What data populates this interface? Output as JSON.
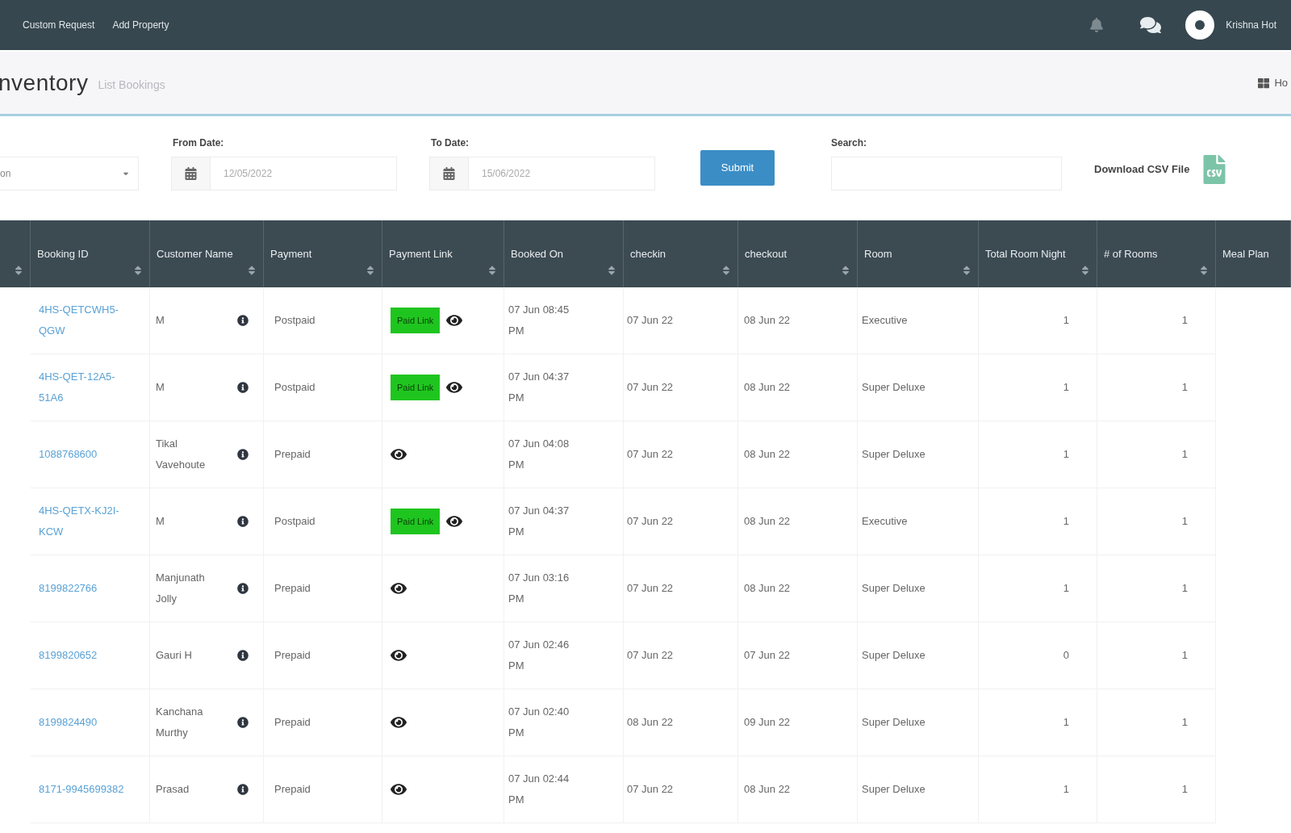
{
  "top_nav": {
    "links": [
      "Custom Request",
      "Add Property"
    ],
    "user_name": "Krishna Hot"
  },
  "page_header": {
    "title": "nventory",
    "subtitle": "List Bookings",
    "breadcrumb": "Ho"
  },
  "filters": {
    "type_select": {
      "value": "on"
    },
    "from_date": {
      "label": "From Date:",
      "value": "12/05/2022"
    },
    "to_date": {
      "label": "To Date:",
      "value": "15/06/2022"
    },
    "submit": "Submit",
    "search": {
      "label": "Search:"
    },
    "download": "Download CSV File"
  },
  "table": {
    "columns": [
      "Booking ID",
      "Customer Name",
      "Payment",
      "Payment Link",
      "Booked On",
      "checkin",
      "checkout",
      "Room",
      "Total Room Night",
      "# of Rooms",
      "Meal Plan"
    ],
    "rows": [
      {
        "booking_id": "4HS-QETCWH5-QGW",
        "customer": "M",
        "payment": "Postpaid",
        "payment_link": "Paid Link",
        "booked_on": "07 Jun 08:45 PM",
        "checkin": "07 Jun 22",
        "checkout": "08 Jun 22",
        "room": "Executive",
        "room_nights": "1",
        "rooms": "1"
      },
      {
        "booking_id": "4HS-QET-12A5-51A6",
        "customer": "M",
        "payment": "Postpaid",
        "payment_link": "Paid Link",
        "booked_on": "07 Jun 04:37 PM",
        "checkin": "07 Jun 22",
        "checkout": "08 Jun 22",
        "room": "Super Deluxe",
        "room_nights": "1",
        "rooms": "1"
      },
      {
        "booking_id": "1088768600",
        "customer": "Tikal Vavehoute",
        "payment": "Prepaid",
        "booked_on": "07 Jun 04:08 PM",
        "checkin": "07 Jun 22",
        "checkout": "08 Jun 22",
        "room": "Super Deluxe",
        "room_nights": "1",
        "rooms": "1"
      },
      {
        "booking_id": "4HS-QETX-KJ2I-KCW",
        "customer": "M",
        "payment": "Postpaid",
        "payment_link": "Paid Link",
        "booked_on": "07 Jun 04:37 PM",
        "checkin": "07 Jun 22",
        "checkout": "08 Jun 22",
        "room": "Executive",
        "room_nights": "1",
        "rooms": "1"
      },
      {
        "booking_id": "8199822766",
        "customer": "Manjunath Jolly",
        "payment": "Prepaid",
        "booked_on": "07 Jun 03:16 PM",
        "checkin": "07 Jun 22",
        "checkout": "08 Jun 22",
        "room": "Super Deluxe",
        "room_nights": "1",
        "rooms": "1"
      },
      {
        "booking_id": "8199820652",
        "customer": "Gauri H",
        "payment": "Prepaid",
        "booked_on": "07 Jun 02:46 PM",
        "checkin": "07 Jun 22",
        "checkout": "07 Jun 22",
        "room": "Super Deluxe",
        "room_nights": "0",
        "rooms": "1"
      },
      {
        "booking_id": "8199824490",
        "customer": "Kanchana Murthy",
        "payment": "Prepaid",
        "booked_on": "07 Jun 02:40 PM",
        "checkin": "08 Jun 22",
        "checkout": "09 Jun 22",
        "room": "Super Deluxe",
        "room_nights": "1",
        "rooms": "1"
      },
      {
        "booking_id": "8171-9945699382",
        "customer": "Prasad",
        "payment": "Prepaid",
        "booked_on": "07 Jun 02:44 PM",
        "checkin": "07 Jun 22",
        "checkout": "08 Jun 22",
        "room": "Super Deluxe",
        "room_nights": "1",
        "rooms": "1"
      }
    ]
  }
}
